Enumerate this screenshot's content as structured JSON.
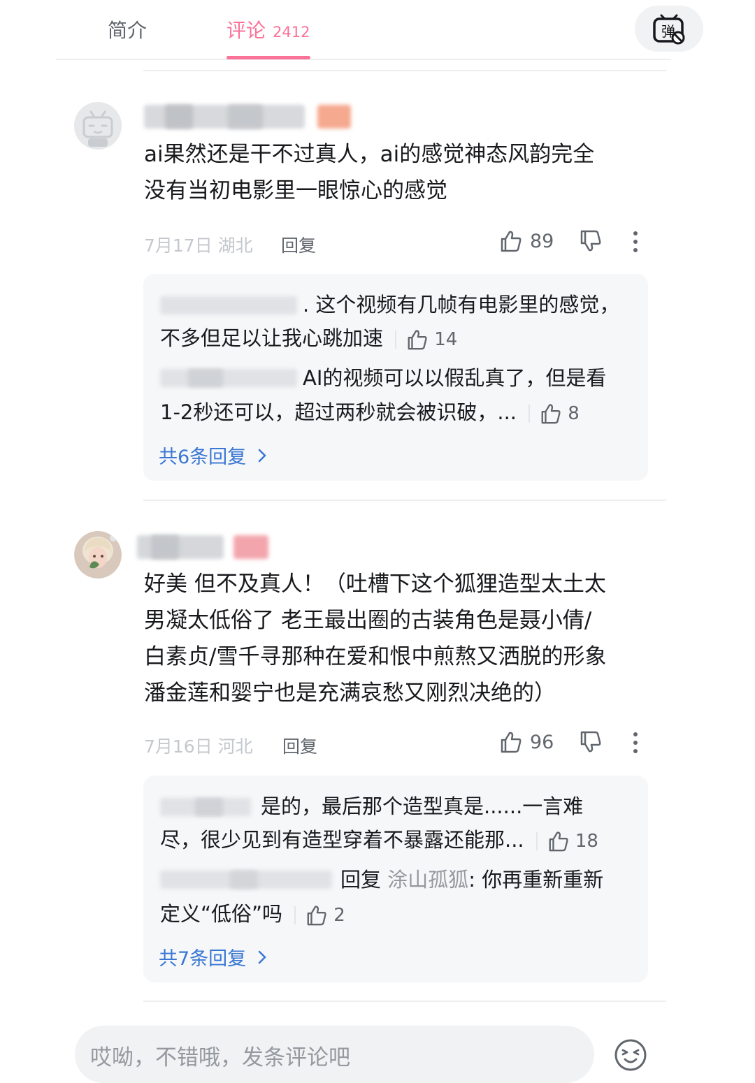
{
  "tabs": {
    "intro_label": "简介",
    "comments_label": "评论",
    "comments_count": "2412",
    "danmaku_icon": "danmaku-toggle-icon",
    "danmaku_label": "弹"
  },
  "comments": [
    {
      "text_line1": "ai果然还是干不过真人，ai的感觉神态风韵完全",
      "text_line2": "没有当初电影里一眼惊心的感觉",
      "date": "7月17日 湖北",
      "reply_label": "回复",
      "likes": "89",
      "replies": [
        {
          "line1": ". 这个视频有几帧有电影里的感觉，",
          "line2": "不多但足以让我心跳加速",
          "likes": "14"
        },
        {
          "line1": "AI的视频可以以假乱真了，但是看",
          "line2": "1-2秒还可以，超过两秒就会被识破，...",
          "likes": "8"
        }
      ],
      "more_replies": "共6条回复"
    },
    {
      "text_line1": "好美 但不及真人！（吐槽下这个狐狸造型太土太",
      "text_line2": "男凝太低俗了 老王最出圈的古装角色是聂小倩/",
      "text_line3": "白素贞/雪千寻那种在爱和恨中煎熬又洒脱的形象",
      "text_line4": "潘金莲和婴宁也是充满哀愁又刚烈决绝的）",
      "date": "7月16日 河北",
      "reply_label": "回复",
      "likes": "96",
      "replies": [
        {
          "line1": "是的，最后那个造型真是......一言难",
          "line2": "尽，很少见到有造型穿着不暴露还能那...",
          "likes": "18"
        },
        {
          "line1_prefix": "回复 ",
          "line1_mention": "涂山孤狐",
          "line1_suffix": ": 你再重新重新",
          "line2": "定义“低俗”吗",
          "likes": "2"
        }
      ],
      "more_replies": "共7条回复"
    }
  ],
  "input": {
    "placeholder": "哎呦，不错哦，发条评论吧"
  },
  "colors": {
    "accent_pink": "#fb7299",
    "link_blue": "#3a77d4",
    "muted_gray": "#9499a0"
  }
}
